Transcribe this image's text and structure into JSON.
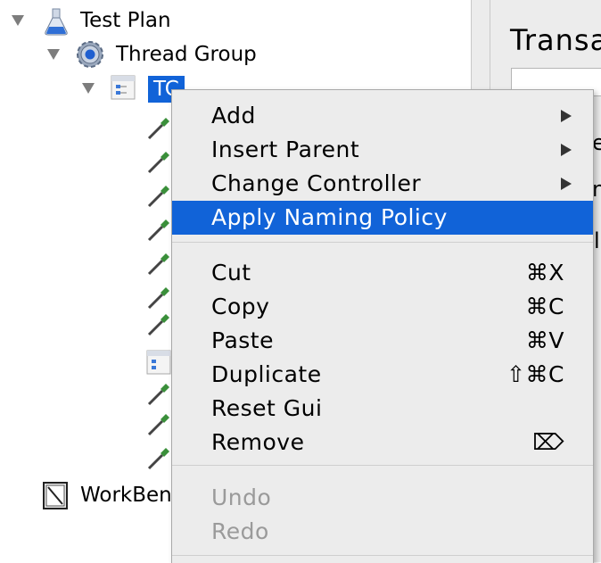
{
  "tree": {
    "root_label": "Test Plan",
    "thread_group_label": "Thread Group",
    "selected_label": "TC",
    "workbench_label": "WorkBench"
  },
  "right_pane": {
    "title": "Transa",
    "fragment_1": "e",
    "fragment_2": "n",
    "fragment_3": "l"
  },
  "context_menu": {
    "add": "Add",
    "insert_parent": "Insert Parent",
    "change_controller": "Change Controller",
    "apply_naming_policy": "Apply Naming Policy",
    "cut": "Cut",
    "cut_shortcut": "⌘X",
    "copy": "Copy",
    "copy_shortcut": "⌘C",
    "paste": "Paste",
    "paste_shortcut": "⌘V",
    "duplicate": "Duplicate",
    "duplicate_shortcut": "⇧⌘C",
    "reset_gui": "Reset Gui",
    "remove": "Remove",
    "remove_shortcut": "⌦",
    "undo": "Undo",
    "redo": "Redo"
  },
  "colors": {
    "selection": "#1163d8",
    "menu_bg": "#ececec",
    "disabled_text": "#9a9a9a"
  }
}
